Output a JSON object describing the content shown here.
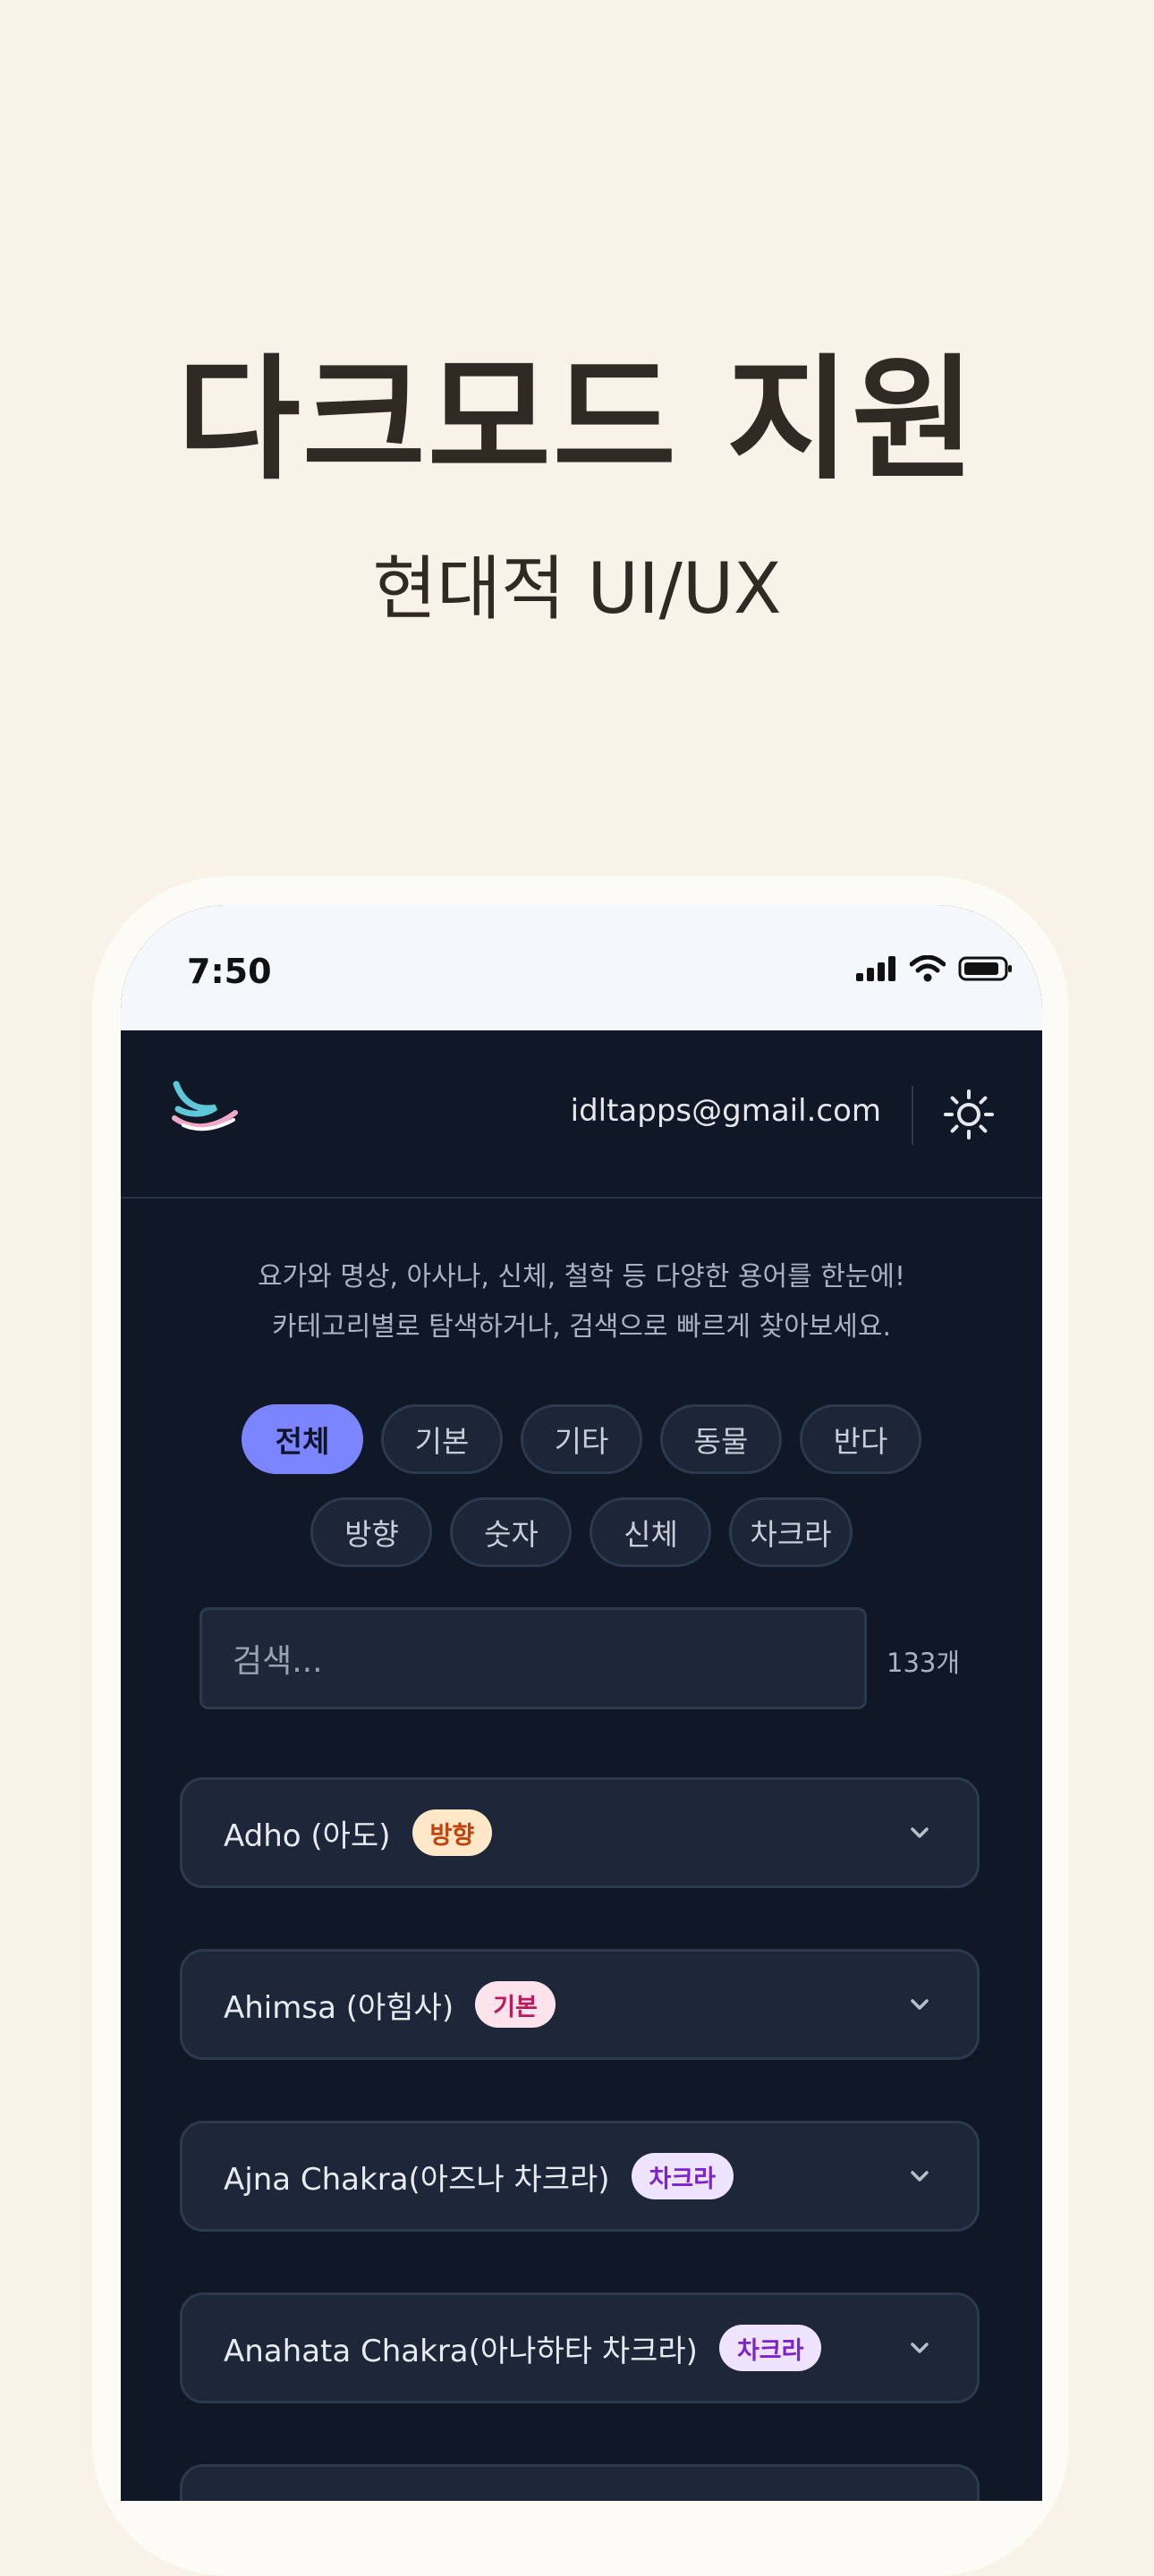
{
  "promo": {
    "title": "다크모드 지원",
    "subtitle": "현대적 UI/UX"
  },
  "status_bar": {
    "time": "7:50",
    "icons": [
      "signal-icon",
      "wifi-icon",
      "battery-icon"
    ]
  },
  "header": {
    "logo_icon": "wave-logo-icon",
    "email": "idltapps@gmail.com",
    "theme_icon": "sun-icon"
  },
  "intro": {
    "line1": "요가와 명상, 아사나, 신체, 철학 등 다양한 용어를 한눈에!",
    "line2": "카테고리별로 탐색하거나, 검색으로 빠르게 찾아보세요."
  },
  "categories": {
    "row1": [
      "전체",
      "기본",
      "기타",
      "동물",
      "반다"
    ],
    "row2": [
      "방향",
      "숫자",
      "신체",
      "차크라"
    ],
    "selected": "전체"
  },
  "search": {
    "placeholder": "검색...",
    "count": "133개"
  },
  "terms": [
    {
      "name": "Adho (아도)",
      "badge": "방향",
      "badge_bg": "#ffe8c7",
      "badge_fg": "#c2410c"
    },
    {
      "name": "Ahimsa (아힘사)",
      "badge": "기본",
      "badge_bg": "#fde4ec",
      "badge_fg": "#be185d"
    },
    {
      "name": "Ajna Chakra(아즈나 차크라)",
      "badge": "차크라",
      "badge_bg": "#efe4ff",
      "badge_fg": "#7e22ce"
    },
    {
      "name": "Anahata Chakra(아나하타 차크라)",
      "badge": "차크라",
      "badge_bg": "#efe4ff",
      "badge_fg": "#7e22ce"
    }
  ],
  "colors": {
    "page_bg": "#f8f2e8",
    "app_bg": "#101828",
    "accent": "#7b85ff"
  }
}
